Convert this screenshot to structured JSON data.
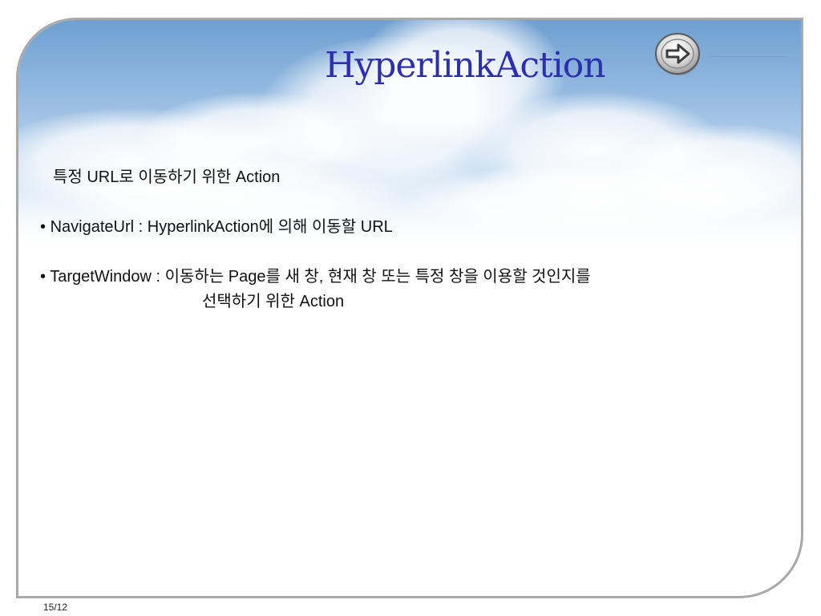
{
  "slide": {
    "title": "HyperlinkAction",
    "intro": "특정 URL로 이동하기 위한 Action",
    "bullets": [
      {
        "marker": "•",
        "term": "NavigateUrl :",
        "desc": "HyperlinkAction에 의해 이동할 URL"
      },
      {
        "marker": "•",
        "term": "TargetWindow :",
        "desc": "이동하는 Page를 새 창, 현재 창 또는 특정 창을 이용할 것인지를",
        "desc_cont": "선택하기 위한 Action"
      }
    ],
    "page_number": "15/12"
  },
  "colors": {
    "title": "#2b2fb0",
    "frame": "#a9a9a9",
    "sky": "#8db5de"
  },
  "icons": {
    "next": "arrow-right-icon"
  }
}
